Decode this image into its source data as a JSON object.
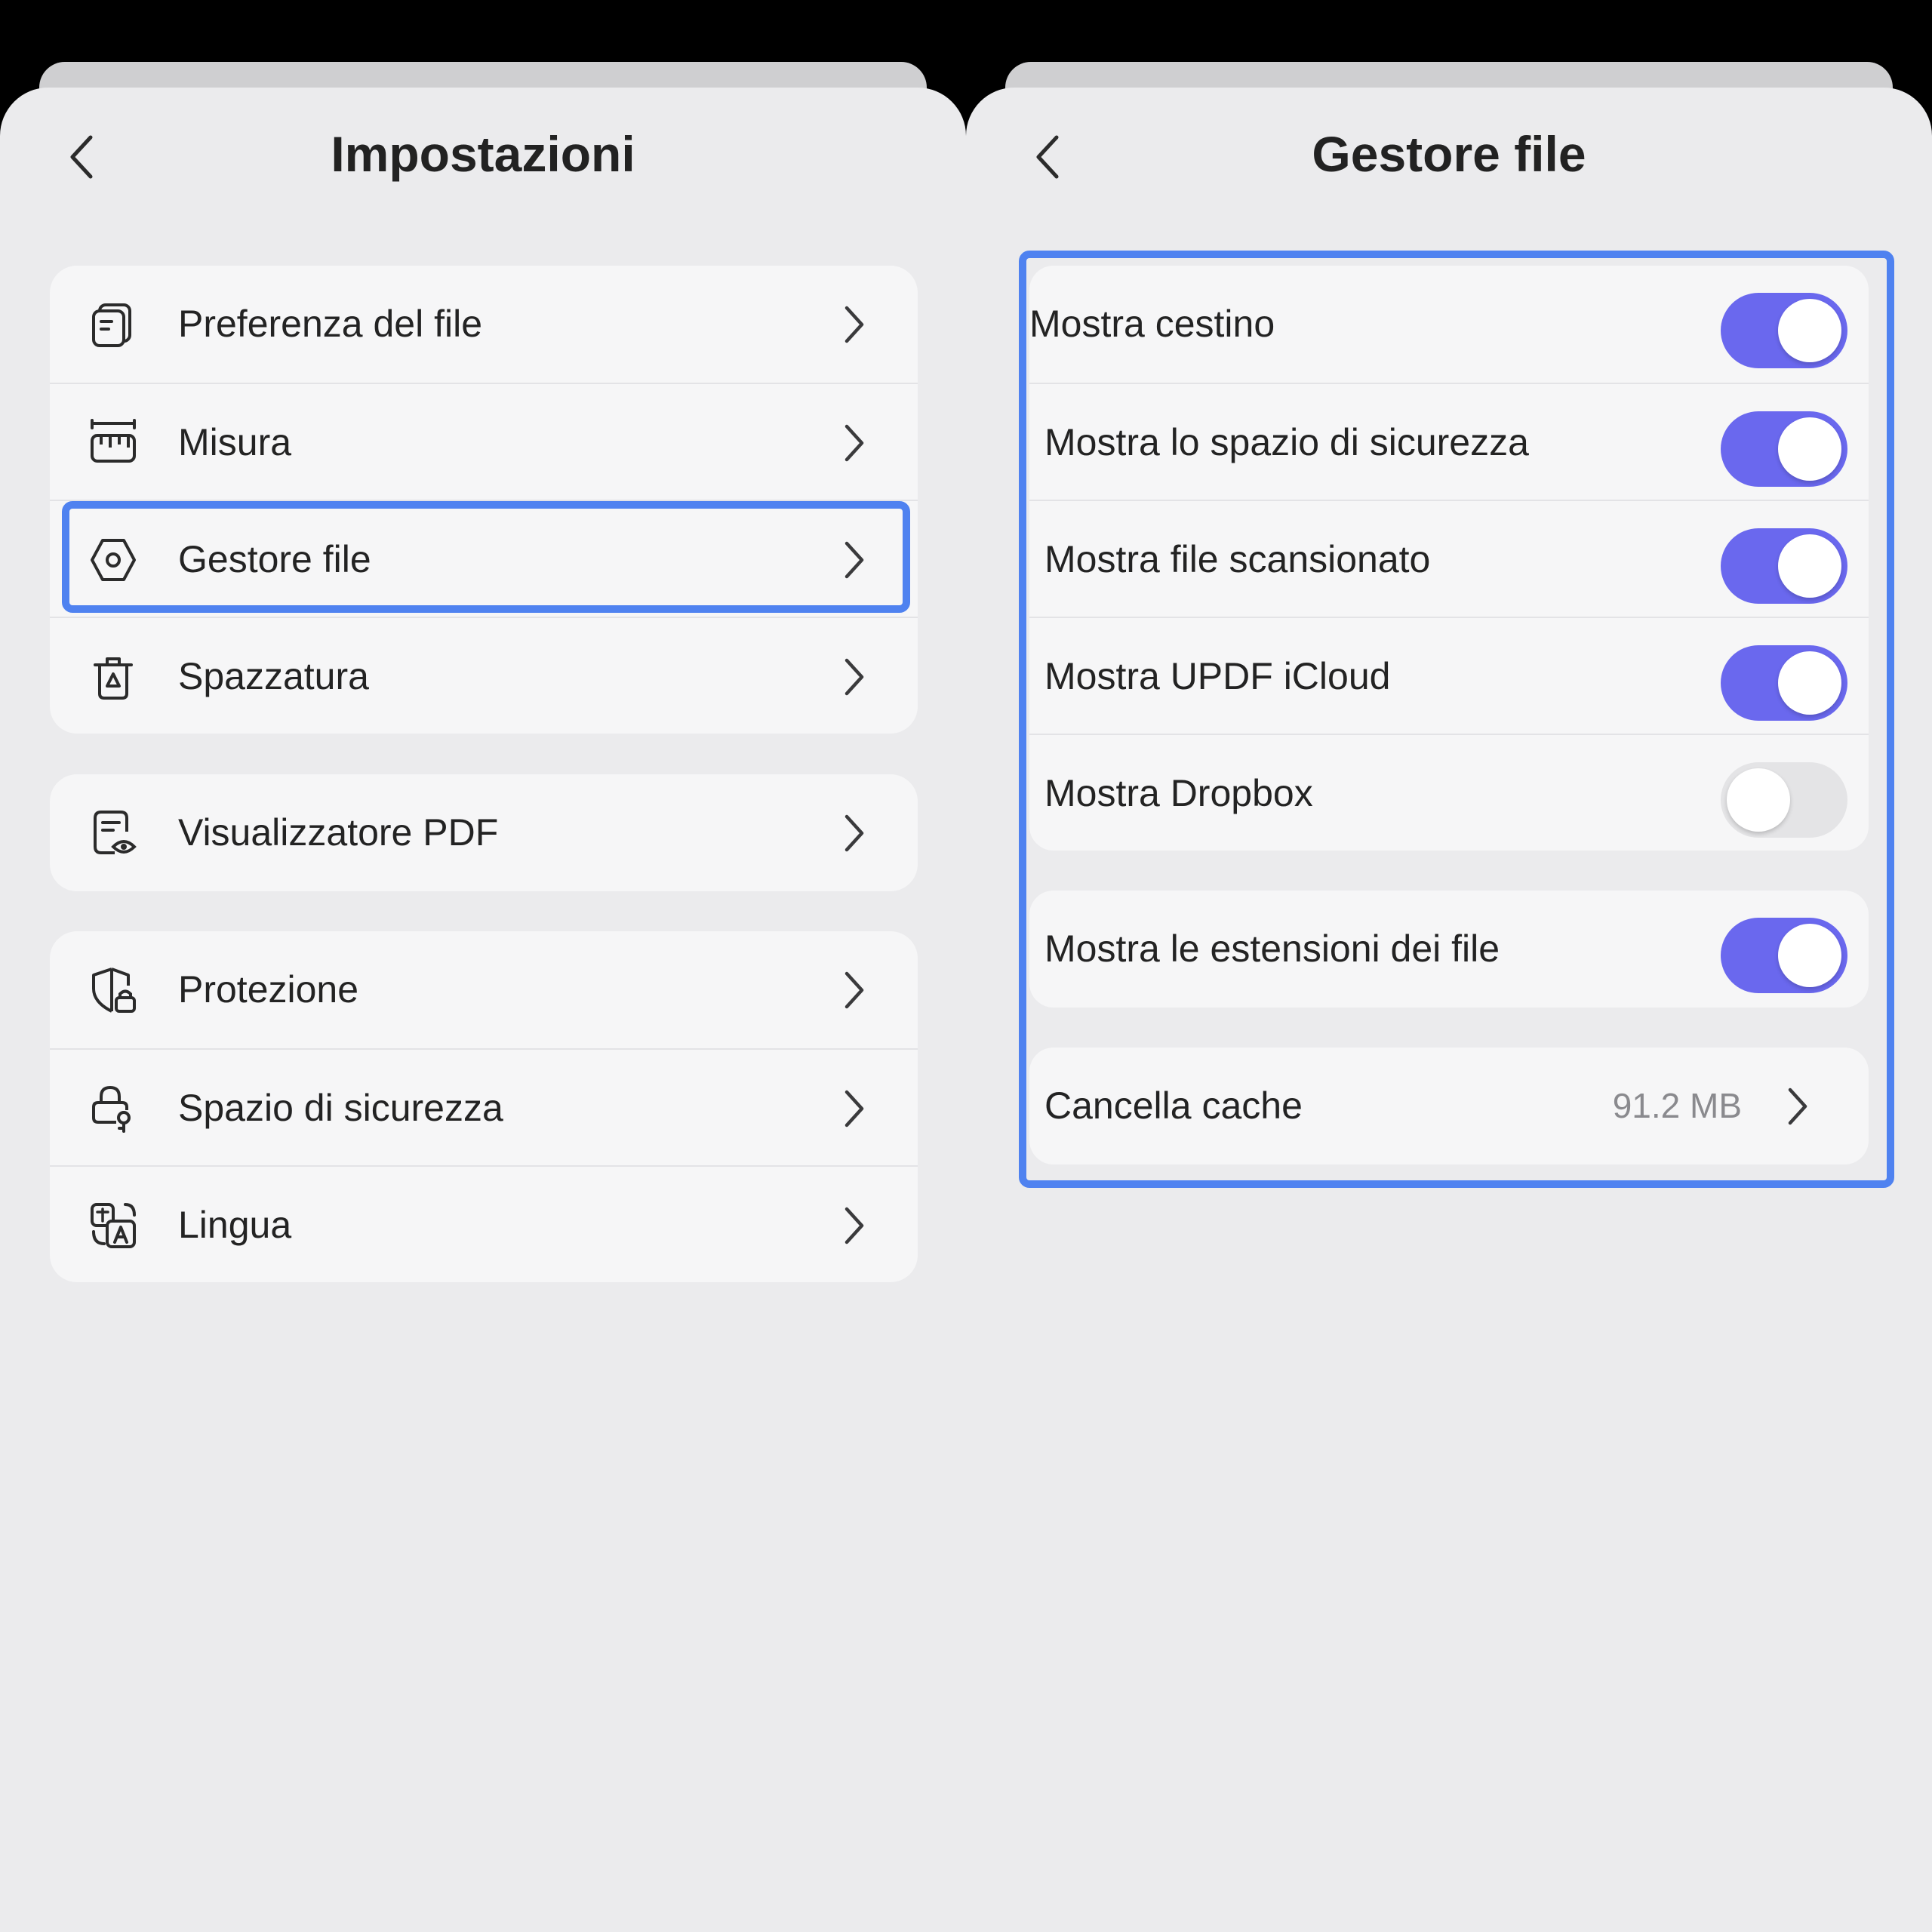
{
  "left": {
    "title": "Impostazioni",
    "groups": [
      [
        {
          "label": "Preferenza del file",
          "icon": "file-preference-icon"
        },
        {
          "label": "Misura",
          "icon": "ruler-icon"
        },
        {
          "label": "Gestore file",
          "icon": "hexagon-nut-icon",
          "highlighted": true
        },
        {
          "label": "Spazzatura",
          "icon": "trash-icon"
        }
      ],
      [
        {
          "label": "Visualizzatore PDF",
          "icon": "pdf-viewer-icon"
        }
      ],
      [
        {
          "label": "Protezione",
          "icon": "shield-lock-icon"
        },
        {
          "label": "Spazio di sicurezza",
          "icon": "security-lock-icon"
        },
        {
          "label": "Lingua",
          "icon": "translate-icon"
        }
      ]
    ]
  },
  "right": {
    "title": "Gestore file",
    "toggles": [
      {
        "label": "Mostra cestino",
        "on": true
      },
      {
        "label": "Mostra lo spazio di sicurezza",
        "on": true
      },
      {
        "label": "Mostra file scansionato",
        "on": true
      },
      {
        "label": "Mostra UPDF iCloud",
        "on": true
      },
      {
        "label": "Mostra Dropbox",
        "on": false
      }
    ],
    "extensions": {
      "label": "Mostra le estensioni dei file",
      "on": true
    },
    "cache": {
      "label": "Cancella cache",
      "value": "91.2 MB"
    }
  },
  "colors": {
    "accent_toggle": "#6a68ee",
    "highlight_border": "#4f82f0",
    "background": "#ebebed"
  }
}
